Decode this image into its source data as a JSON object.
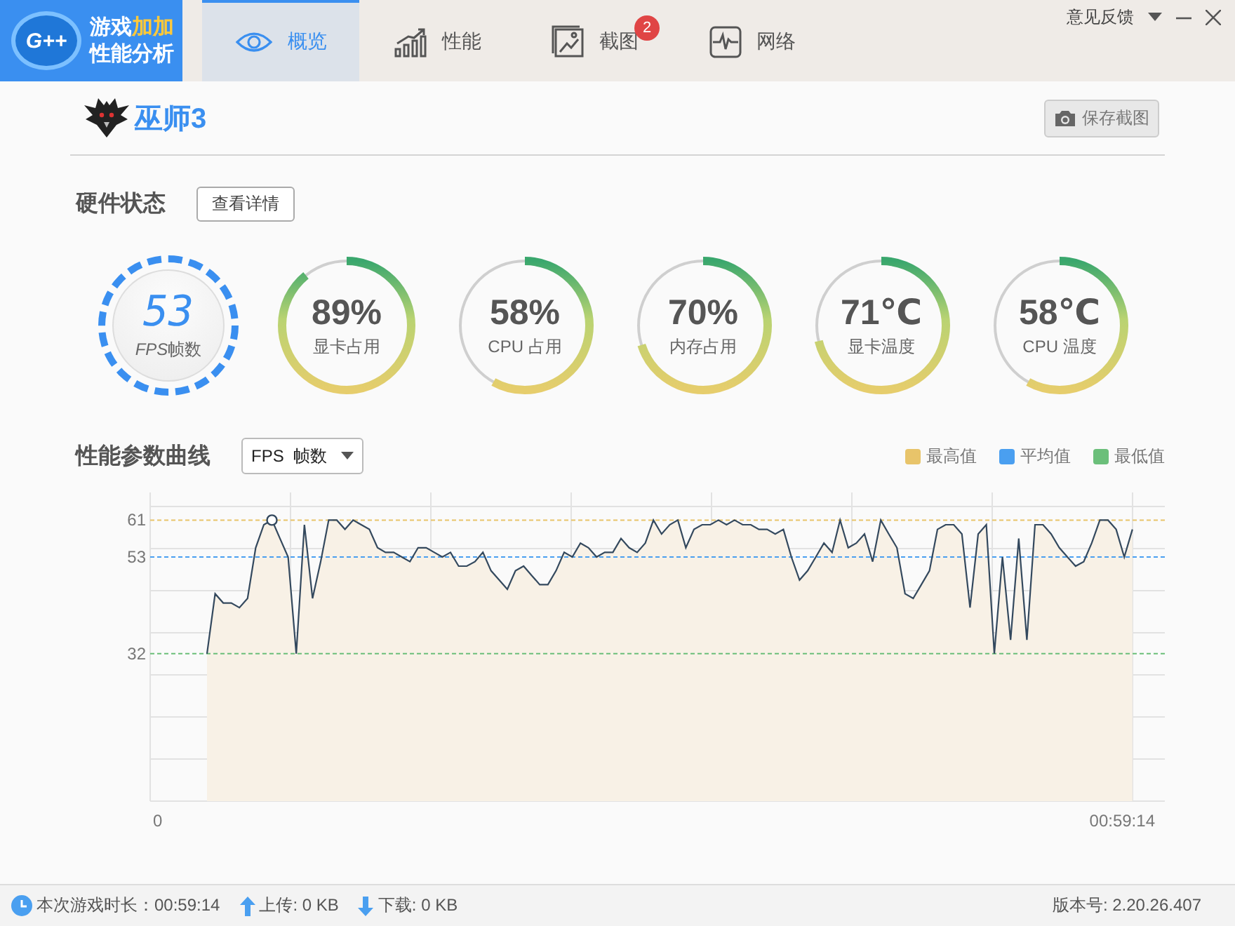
{
  "brand": {
    "logo_mark": "G++",
    "title_parts": [
      "游戏",
      "加加"
    ],
    "subtitle": "性能分析"
  },
  "tabs": [
    {
      "label": "概览",
      "selected": true
    },
    {
      "label": "性能",
      "selected": false
    },
    {
      "label": "截图",
      "selected": false,
      "badge": "2"
    },
    {
      "label": "网络",
      "selected": false
    }
  ],
  "window_controls": {
    "feedback": "意见反馈"
  },
  "game": {
    "title": "巫师3",
    "save_button": "保存截图"
  },
  "hardware": {
    "title": "硬件状态",
    "details_button": "查看详情",
    "gauges": [
      {
        "kind": "fps",
        "value": "53",
        "label_parts": [
          "FPS",
          "帧数"
        ]
      },
      {
        "kind": "ring",
        "value": "89%",
        "label": "显卡占用",
        "level": 0.89
      },
      {
        "kind": "ring",
        "value": "58%",
        "label": "CPU 占用",
        "level": 0.58
      },
      {
        "kind": "ring",
        "value": "70%",
        "label": "内存占用",
        "level": 0.7
      },
      {
        "kind": "ring",
        "value": "71℃",
        "label": "显卡温度",
        "level": 0.71
      },
      {
        "kind": "ring",
        "value": "58℃",
        "label": "CPU 温度",
        "level": 0.58
      }
    ]
  },
  "curve": {
    "title": "性能参数曲线",
    "metric_select": "FPS  帧数",
    "legend": [
      {
        "label": "最高值",
        "color": "#e8c46a"
      },
      {
        "label": "平均值",
        "color": "#4a9ff0"
      },
      {
        "label": "最低值",
        "color": "#6bbf7a"
      }
    ],
    "axis_start": "0",
    "axis_end": "00:59:14",
    "chart_data": {
      "type": "line",
      "ylim": [
        0,
        67
      ],
      "yticks": [
        32,
        53,
        61
      ],
      "series": [
        {
          "color": "#34495e",
          "line_style": "solid",
          "values": [
            null,
            null,
            null,
            null,
            null,
            null,
            null,
            32,
            45,
            43,
            43,
            42,
            44,
            55,
            60,
            61,
            57,
            53,
            32,
            60,
            44,
            52,
            61,
            61,
            59,
            61,
            60,
            59,
            55,
            54,
            54,
            53,
            52,
            55,
            55,
            54,
            53,
            54,
            51,
            51,
            52,
            54,
            50,
            48,
            46,
            50,
            51,
            49,
            47,
            47,
            50,
            54,
            53,
            56,
            55,
            53,
            54,
            54,
            57,
            55,
            54,
            56,
            61,
            58,
            60,
            61,
            55,
            59,
            60,
            60,
            61,
            60,
            61,
            60,
            60,
            59,
            59,
            58,
            59,
            53,
            48,
            50,
            53,
            56,
            54,
            61,
            55,
            56,
            58,
            52,
            61,
            58,
            55,
            45,
            44,
            47,
            50,
            59,
            60,
            60,
            58,
            42,
            58,
            60,
            32,
            53,
            35,
            57,
            35,
            60,
            60,
            58,
            55,
            53,
            51,
            52,
            56,
            61,
            61,
            59,
            53,
            59,
            null,
            null,
            null,
            null
          ]
        },
        {
          "color": "#e8c46a",
          "line_style": "dashed",
          "values": [
            61,
            61,
            61,
            61,
            61,
            61,
            61,
            61,
            61,
            61,
            61,
            61,
            61,
            61,
            61,
            61,
            61,
            61,
            61,
            61,
            61,
            61,
            61,
            61,
            61,
            61,
            61,
            61,
            61,
            61,
            61,
            61,
            61,
            61,
            61,
            61,
            61,
            61,
            61,
            61,
            61,
            61,
            61,
            61,
            61,
            61,
            61,
            61,
            61,
            61,
            61,
            61,
            61,
            61,
            61,
            61,
            61,
            61,
            61,
            61,
            61,
            61,
            61,
            61,
            61,
            61,
            61,
            61,
            61,
            61,
            61,
            61,
            61,
            61,
            61,
            61,
            61,
            61,
            61,
            61,
            61,
            61,
            61,
            61,
            61,
            61,
            61,
            61,
            61,
            61,
            61,
            61,
            61,
            61,
            61,
            61,
            61,
            61,
            61,
            61,
            61,
            61,
            61,
            61,
            61,
            61,
            61,
            61,
            61,
            61,
            61,
            61,
            61,
            61,
            61,
            61,
            61,
            61,
            61,
            61,
            61,
            61,
            61,
            61,
            61,
            61
          ]
        },
        {
          "color": "#4a9ff0",
          "line_style": "dashed",
          "values": [
            53,
            53,
            53,
            53,
            53,
            53,
            53,
            53,
            53,
            53,
            53,
            53,
            53,
            53,
            53,
            53,
            53,
            53,
            53,
            53,
            53,
            53,
            53,
            53,
            53,
            53,
            53,
            53,
            53,
            53,
            53,
            53,
            53,
            53,
            53,
            53,
            53,
            53,
            53,
            53,
            53,
            53,
            53,
            53,
            53,
            53,
            53,
            53,
            53,
            53,
            53,
            53,
            53,
            53,
            53,
            53,
            53,
            53,
            53,
            53,
            53,
            53,
            53,
            53,
            53,
            53,
            53,
            53,
            53,
            53,
            53,
            53,
            53,
            53,
            53,
            53,
            53,
            53,
            53,
            53,
            53,
            53,
            53,
            53,
            53,
            53,
            53,
            53,
            53,
            53,
            53,
            53,
            53,
            53,
            53,
            53,
            53,
            53,
            53,
            53,
            53,
            53,
            53,
            53,
            53,
            53,
            53,
            53,
            53,
            53,
            53,
            53,
            53,
            53,
            53,
            53,
            53,
            53,
            53,
            53,
            53,
            53,
            53,
            53,
            53,
            53
          ]
        },
        {
          "color": "#6bbf7a",
          "line_style": "dashed",
          "values": [
            32,
            32,
            32,
            32,
            32,
            32,
            32,
            32,
            32,
            32,
            32,
            32,
            32,
            32,
            32,
            32,
            32,
            32,
            32,
            32,
            32,
            32,
            32,
            32,
            32,
            32,
            32,
            32,
            32,
            32,
            32,
            32,
            32,
            32,
            32,
            32,
            32,
            32,
            32,
            32,
            32,
            32,
            32,
            32,
            32,
            32,
            32,
            32,
            32,
            32,
            32,
            32,
            32,
            32,
            32,
            32,
            32,
            32,
            32,
            32,
            32,
            32,
            32,
            32,
            32,
            32,
            32,
            32,
            32,
            32,
            32,
            32,
            32,
            32,
            32,
            32,
            32,
            32,
            32,
            32,
            32,
            32,
            32,
            32,
            32,
            32,
            32,
            32,
            32,
            32,
            32,
            32,
            32,
            32,
            32,
            32,
            32,
            32,
            32,
            32,
            32,
            32,
            32,
            32,
            32,
            32,
            32,
            32,
            32,
            32,
            32,
            32,
            32,
            32,
            32,
            32,
            32,
            32,
            32,
            32,
            32,
            32,
            32,
            32,
            32,
            32
          ]
        }
      ]
    }
  },
  "status_bar": {
    "duration": "本次游戏时长：00:59:14",
    "upload": "上传: 0 KB",
    "download": "下载: 0 KB",
    "version": "版本号:  2.20.26.407"
  }
}
